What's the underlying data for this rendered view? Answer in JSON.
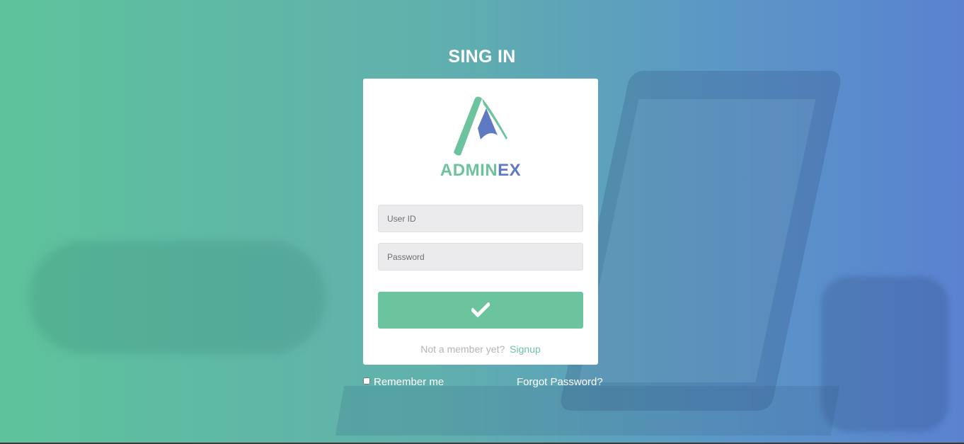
{
  "page": {
    "title": "SING IN"
  },
  "brand": {
    "logo_part_a": "ADMIN",
    "logo_part_b": "EX",
    "primary_color": "#6cc49f",
    "secondary_color": "#5f79c3"
  },
  "form": {
    "user_id_placeholder": "User ID",
    "password_placeholder": "Password",
    "submit_icon": "check-icon"
  },
  "signup": {
    "prompt": "Not a member yet?",
    "link_label": "Signup"
  },
  "footer": {
    "remember_label": "Remember me",
    "remember_checked": false,
    "forgot_label": "Forgot Password?"
  }
}
